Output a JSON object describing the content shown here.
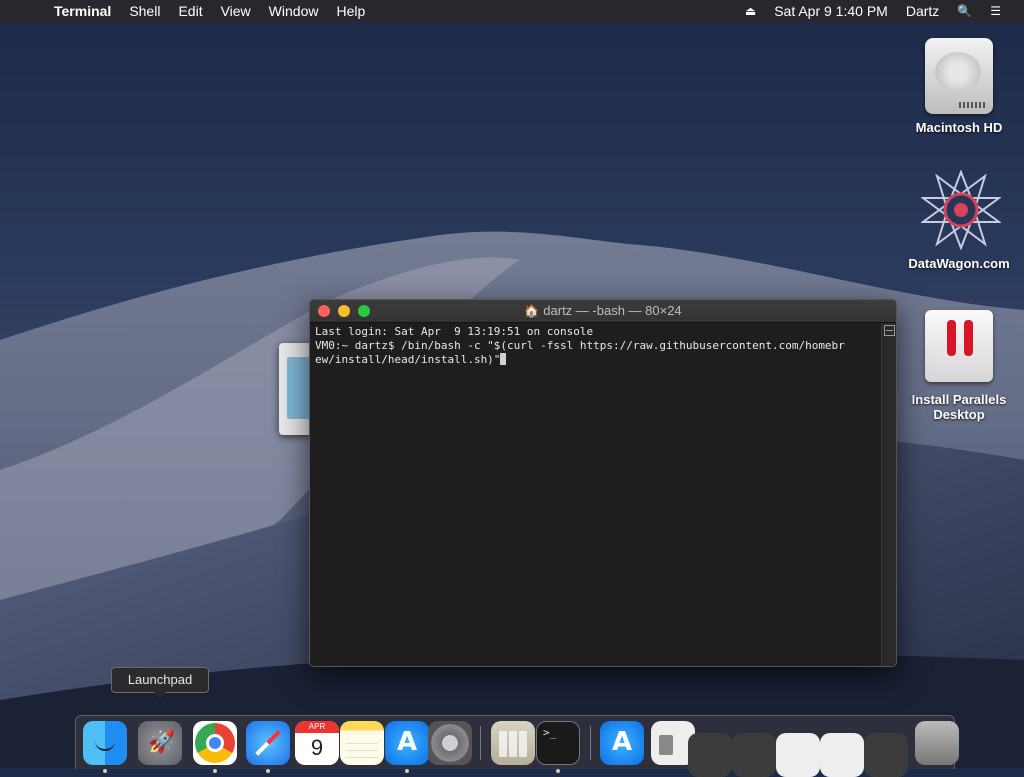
{
  "menubar": {
    "app_name": "Terminal",
    "menus": [
      "Shell",
      "Edit",
      "View",
      "Window",
      "Help"
    ],
    "datetime": "Sat Apr 9  1:40 PM",
    "user": "Dartz"
  },
  "desktop": {
    "icons": [
      {
        "label": "Macintosh HD"
      },
      {
        "label": "DataWagon.com"
      },
      {
        "label": "Install Parallels Desktop"
      }
    ]
  },
  "terminal": {
    "title": "dartz — -bash — 80×24",
    "lines": [
      "Last login: Sat Apr  9 13:19:51 on console",
      "VM0:~ dartz$ /bin/bash -c \"$(curl -fssl https://raw.githubusercontent.com/homebr",
      "ew/install/head/install.sh)\""
    ]
  },
  "dock": {
    "tooltip": "Launchpad",
    "calendar_month": "APR",
    "calendar_day": "9"
  },
  "colors": {
    "menubar_bg": "#28282c",
    "terminal_bg": "#1e1e1e",
    "close": "#fe5f57",
    "minimize": "#febc2e",
    "zoom": "#28c840"
  }
}
